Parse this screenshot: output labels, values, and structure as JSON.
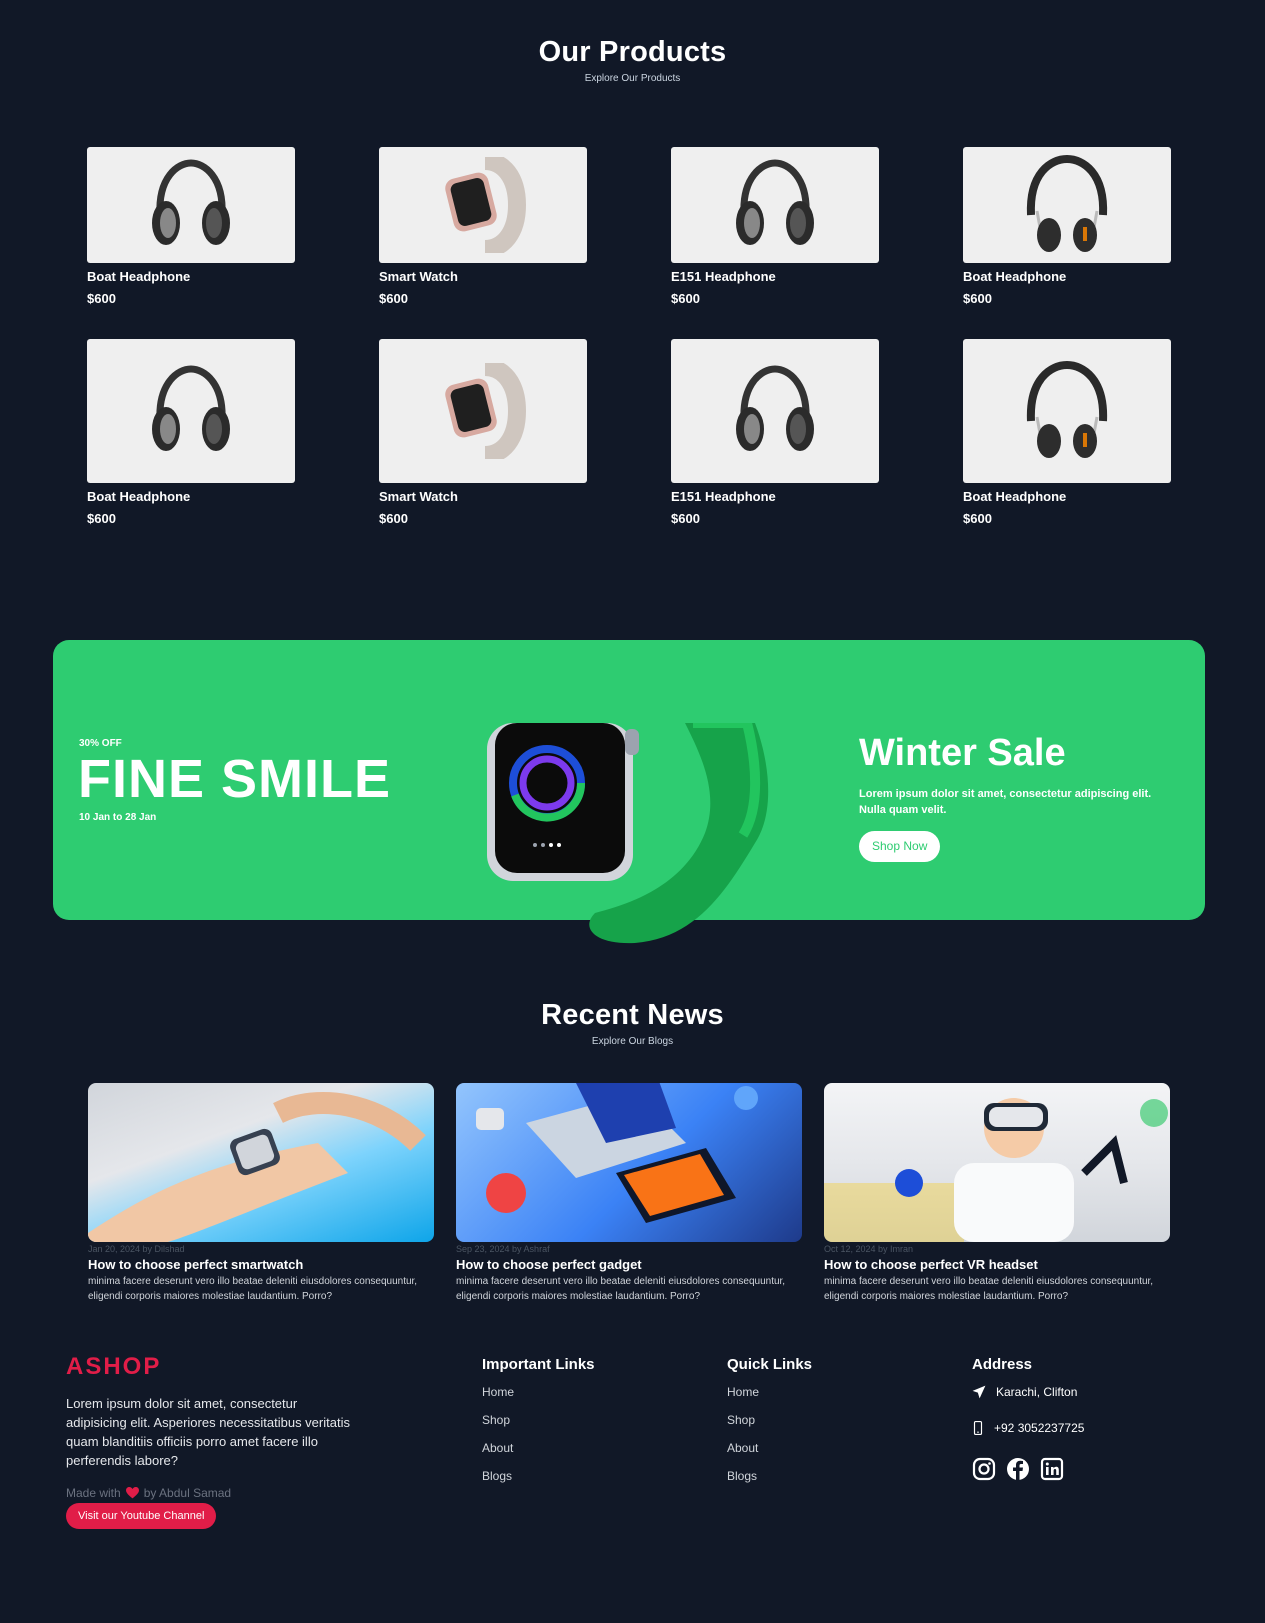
{
  "products_section": {
    "title": "Our Products",
    "subtitle": "Explore Our Products"
  },
  "products": [
    {
      "name": "Boat Headphone",
      "price": "$600"
    },
    {
      "name": "Smart Watch",
      "price": "$600"
    },
    {
      "name": "E151 Headphone",
      "price": "$600"
    },
    {
      "name": "Boat Headphone",
      "price": "$600"
    },
    {
      "name": "Boat Headphone",
      "price": "$600"
    },
    {
      "name": "Smart Watch",
      "price": "$600"
    },
    {
      "name": "E151 Headphone",
      "price": "$600"
    },
    {
      "name": "Boat Headphone",
      "price": "$600"
    }
  ],
  "banner": {
    "discount": "30% OFF",
    "title": "FINE SMILE",
    "dates": "10 Jan to 28 Jan",
    "sale_title": "Winter Sale",
    "description": "Lorem ipsum dolor sit amet, consectetur adipiscing elit. Nulla quam velit.",
    "button": "Shop Now",
    "color": "#2ecc71"
  },
  "news_section": {
    "title": "Recent News",
    "subtitle": "Explore Our Blogs"
  },
  "news": [
    {
      "meta": "Jan 20, 2024 by Dilshad",
      "title": "How to choose perfect smartwatch",
      "text": "minima facere deserunt vero illo beatae deleniti eiusdolores consequuntur, eligendi corporis maiores molestiae laudantium. Porro?"
    },
    {
      "meta": "Sep 23, 2024 by Ashraf",
      "title": "How to choose perfect gadget",
      "text": "minima facere deserunt vero illo beatae deleniti eiusdolores consequuntur, eligendi corporis maiores molestiae laudantium. Porro?"
    },
    {
      "meta": "Oct 12, 2024 by Imran",
      "title": "How to choose perfect VR headset",
      "text": "minima facere deserunt vero illo beatae deleniti eiusdolores consequuntur, eligendi corporis maiores molestiae laudantium. Porro?"
    }
  ],
  "footer": {
    "logo": "ASHOP",
    "about": "Lorem ipsum dolor sit amet, consectetur adipisicing elit. Asperiores necessitatibus veritatis quam blanditiis officiis porro amet facere illo perferendis labore?",
    "made_with_prefix": "Made with",
    "made_with_suffix": "by Abdul Samad",
    "youtube_button": "Visit our Youtube Channel",
    "important_links": {
      "title": "Important Links",
      "items": [
        "Home",
        "Shop",
        "About",
        "Blogs"
      ]
    },
    "quick_links": {
      "title": "Quick Links",
      "items": [
        "Home",
        "Shop",
        "About",
        "Blogs"
      ]
    },
    "address": {
      "title": "Address",
      "location": "Karachi, Clifton",
      "phone": "+92 3052237725"
    },
    "accent_color": "#e11d48"
  }
}
